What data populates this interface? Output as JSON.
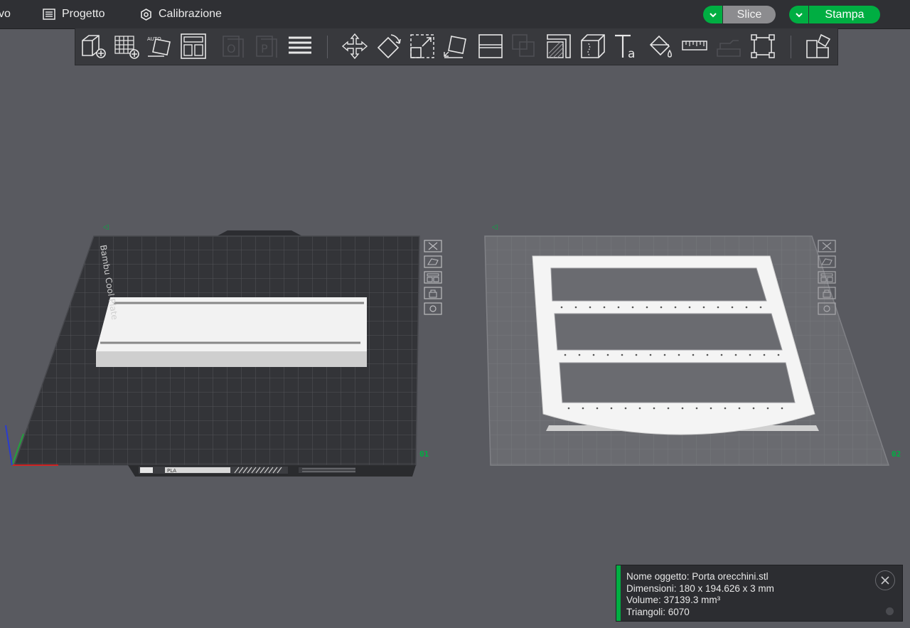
{
  "menu": {
    "cut_item": "vo",
    "project_label": "Progetto",
    "calibration_label": "Calibrazione"
  },
  "actions": {
    "slice_label": "Slice",
    "print_label": "Stampa"
  },
  "colors": {
    "accent": "#00ae42",
    "background": "#595a60",
    "topbar": "#2f3034"
  },
  "toolbar": {
    "tools": [
      {
        "name": "add-object-icon"
      },
      {
        "name": "add-plate-icon"
      },
      {
        "name": "auto-orient-icon"
      },
      {
        "name": "arrange-icon"
      },
      {
        "name": "split-objects-icon"
      },
      {
        "name": "split-parts-icon"
      },
      {
        "name": "layers-icon"
      },
      {
        "name": "move-icon"
      },
      {
        "name": "rotate-icon"
      },
      {
        "name": "scale-icon"
      },
      {
        "name": "lay-on-face-icon"
      },
      {
        "name": "cut-icon"
      },
      {
        "name": "mesh-boolean-icon"
      },
      {
        "name": "support-paint-icon"
      },
      {
        "name": "seam-paint-icon"
      },
      {
        "name": "text-icon"
      },
      {
        "name": "color-paint-icon"
      },
      {
        "name": "measure-icon"
      },
      {
        "name": "assembly-icon"
      },
      {
        "name": "fit-view-icon"
      },
      {
        "name": "variable-layer-icon"
      }
    ]
  },
  "plates": [
    {
      "label": "Bambu Cool Plate",
      "number": "01",
      "tag": "PLA",
      "selected": true,
      "buttons": [
        "close-plate-icon",
        "auto-orient-plate-icon",
        "arrange-plate-icon",
        "lock-plate-icon",
        "plate-settings-icon"
      ]
    },
    {
      "number": "02",
      "selected": false,
      "buttons": [
        "close-plate-icon",
        "auto-orient-plate-icon",
        "arrange-plate-icon",
        "lock-plate-icon",
        "plate-settings-icon"
      ]
    }
  ],
  "object_info": {
    "name_line": "Nome oggetto: Porta orecchini.stl",
    "dimensions_line": "Dimensioni: 180 x 194.626 x 3 mm",
    "volume_line": "Volume: 37139.3 mm³",
    "triangles_line": "Triangoli: 6070"
  }
}
